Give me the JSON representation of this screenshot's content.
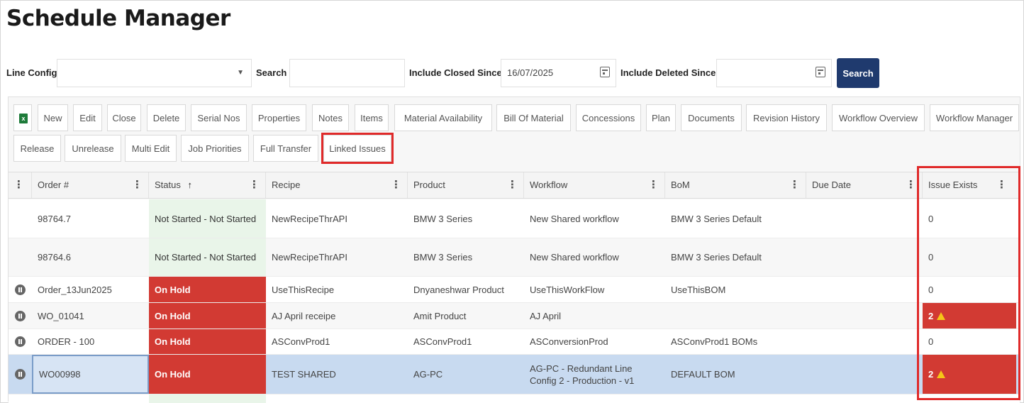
{
  "page_title": "Schedule Manager",
  "filters": {
    "line_config_label": "Line Config",
    "line_config_value": "",
    "search_label": "Search",
    "search_value": "",
    "closed_since_label": "Include Closed Since",
    "closed_since_value": "16/07/2025",
    "deleted_since_label": "Include Deleted Since",
    "deleted_since_value": "",
    "search_button": "Search"
  },
  "toolbar_row1": [
    "New",
    "Edit",
    "Close",
    "Delete",
    "Serial Nos",
    "Properties",
    "Notes",
    "Items",
    "Material Availability",
    "Bill Of Material",
    "Concessions",
    "Plan",
    "Documents",
    "Revision History",
    "Workflow Overview",
    "Workflow Manager"
  ],
  "toolbar_row2": [
    "Release",
    "Unrelease",
    "Multi Edit",
    "Job Priorities",
    "Full Transfer",
    "Linked Issues"
  ],
  "columns": [
    "Order #",
    "Status",
    "Recipe",
    "Product",
    "Workflow",
    "BoM",
    "Due Date",
    "Issue Exists"
  ],
  "sort_indicator": "↑",
  "rows": [
    {
      "order": "98764.7",
      "status": "Not Started - Not Started",
      "recipe": "NewRecipeThrAPI",
      "product": "BMW 3 Series",
      "workflow": "New Shared workflow",
      "bom": "BMW 3 Series Default",
      "due": "",
      "issue": "0"
    },
    {
      "order": "98764.6",
      "status": "Not Started - Not Started",
      "recipe": "NewRecipeThrAPI",
      "product": "BMW 3 Series",
      "workflow": "New Shared workflow",
      "bom": "BMW 3 Series Default",
      "due": "",
      "issue": "0"
    },
    {
      "order": "Order_13Jun2025",
      "status": "On Hold",
      "recipe": "UseThisRecipe",
      "product": "Dnyaneshwar Product",
      "workflow": "UseThisWorkFlow",
      "bom": "UseThisBOM",
      "due": "",
      "issue": "0"
    },
    {
      "order": "WO_01041",
      "status": "On Hold",
      "recipe": "AJ April receipe",
      "product": "Amit Product",
      "workflow": "AJ April",
      "bom": "",
      "due": "",
      "issue": "2"
    },
    {
      "order": "ORDER - 100",
      "status": "On Hold",
      "recipe": "ASConvProd1",
      "product": "ASConvProd1",
      "workflow": "ASConversionProd",
      "bom": "ASConvProd1 BOMs",
      "due": "",
      "issue": "0"
    },
    {
      "order": "WO00998",
      "status": "On Hold",
      "recipe": "TEST SHARED",
      "product": "AG-PC",
      "workflow": "AG-PC - Redundant Line Config 2 - Production - v1",
      "bom": "DEFAULT BOM",
      "due": "",
      "issue": "2"
    }
  ],
  "colors": {
    "on_hold": "#d23a33",
    "not_started": "#e9f5e9",
    "selected_row": "#c8daf0",
    "highlight_box": "#e02a2a",
    "search_button": "#1f3a6e"
  }
}
